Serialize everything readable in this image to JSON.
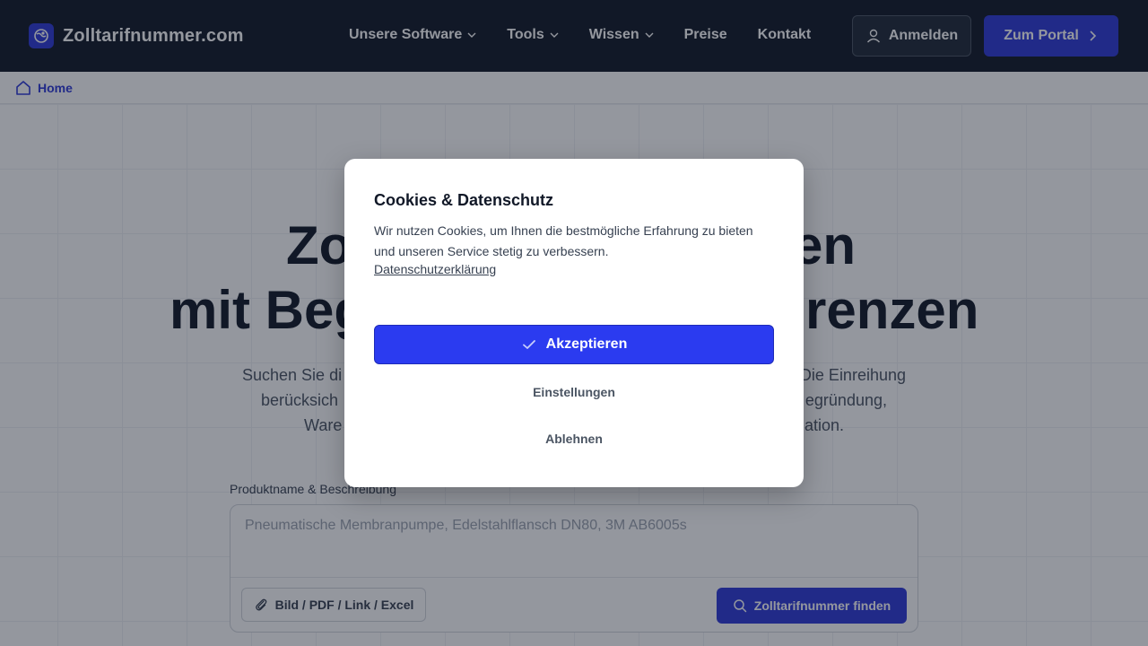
{
  "header": {
    "brand": "Zolltarifnummer.com",
    "nav": [
      {
        "label": "Unsere Software",
        "has_dropdown": true
      },
      {
        "label": "Tools",
        "has_dropdown": true
      },
      {
        "label": "Wissen",
        "has_dropdown": true
      },
      {
        "label": "Preise",
        "has_dropdown": false
      },
      {
        "label": "Kontakt",
        "has_dropdown": false
      }
    ],
    "login_label": "Anmelden",
    "portal_label": "Zum Portal"
  },
  "breadcrumb": {
    "home_label": "Home"
  },
  "hero": {
    "title_line1_left": "Zo",
    "title_line1_right": "en",
    "title_line2_left": "mit Beg",
    "title_line2_right": "renzen",
    "sub_line1_left": "Suchen Sie di",
    "sub_line1_right": "Die Einreihung",
    "sub_line2_left": "berücksich",
    "sub_line2_right": "egründung,",
    "sub_line3_left": "Ware",
    "sub_line3_right": "ation.",
    "field_label": "Produktname & Beschreibung",
    "search_placeholder": "Pneumatische Membranpumpe, Edelstahlflansch DN80, 3M AB6005s",
    "attach_label": "Bild / PDF / Link / Excel",
    "find_label": "Zolltarifnummer finden"
  },
  "cookie_modal": {
    "title": "Cookies & Datenschutz",
    "text": "Wir nutzen Cookies, um Ihnen die bestmögliche Erfahrung zu bieten und unseren Service stetig zu verbessern.",
    "privacy_link": "Datenschutzerklärung",
    "accept_label": "Akzeptieren",
    "settings_label": "Einstellungen",
    "decline_label": "Ablehnen"
  },
  "colors": {
    "header_bg": "#111827",
    "brand_blue": "#2f3ad8",
    "accept_blue": "#2b3bf0"
  },
  "icons": {
    "brand": "globe-logo-icon",
    "login": "user-icon",
    "portal": "chevron-right-icon",
    "breadcrumb": "home-icon",
    "attach": "paperclip-icon",
    "find": "search-icon",
    "accept": "check-icon",
    "dropdown": "chevron-down-icon"
  }
}
